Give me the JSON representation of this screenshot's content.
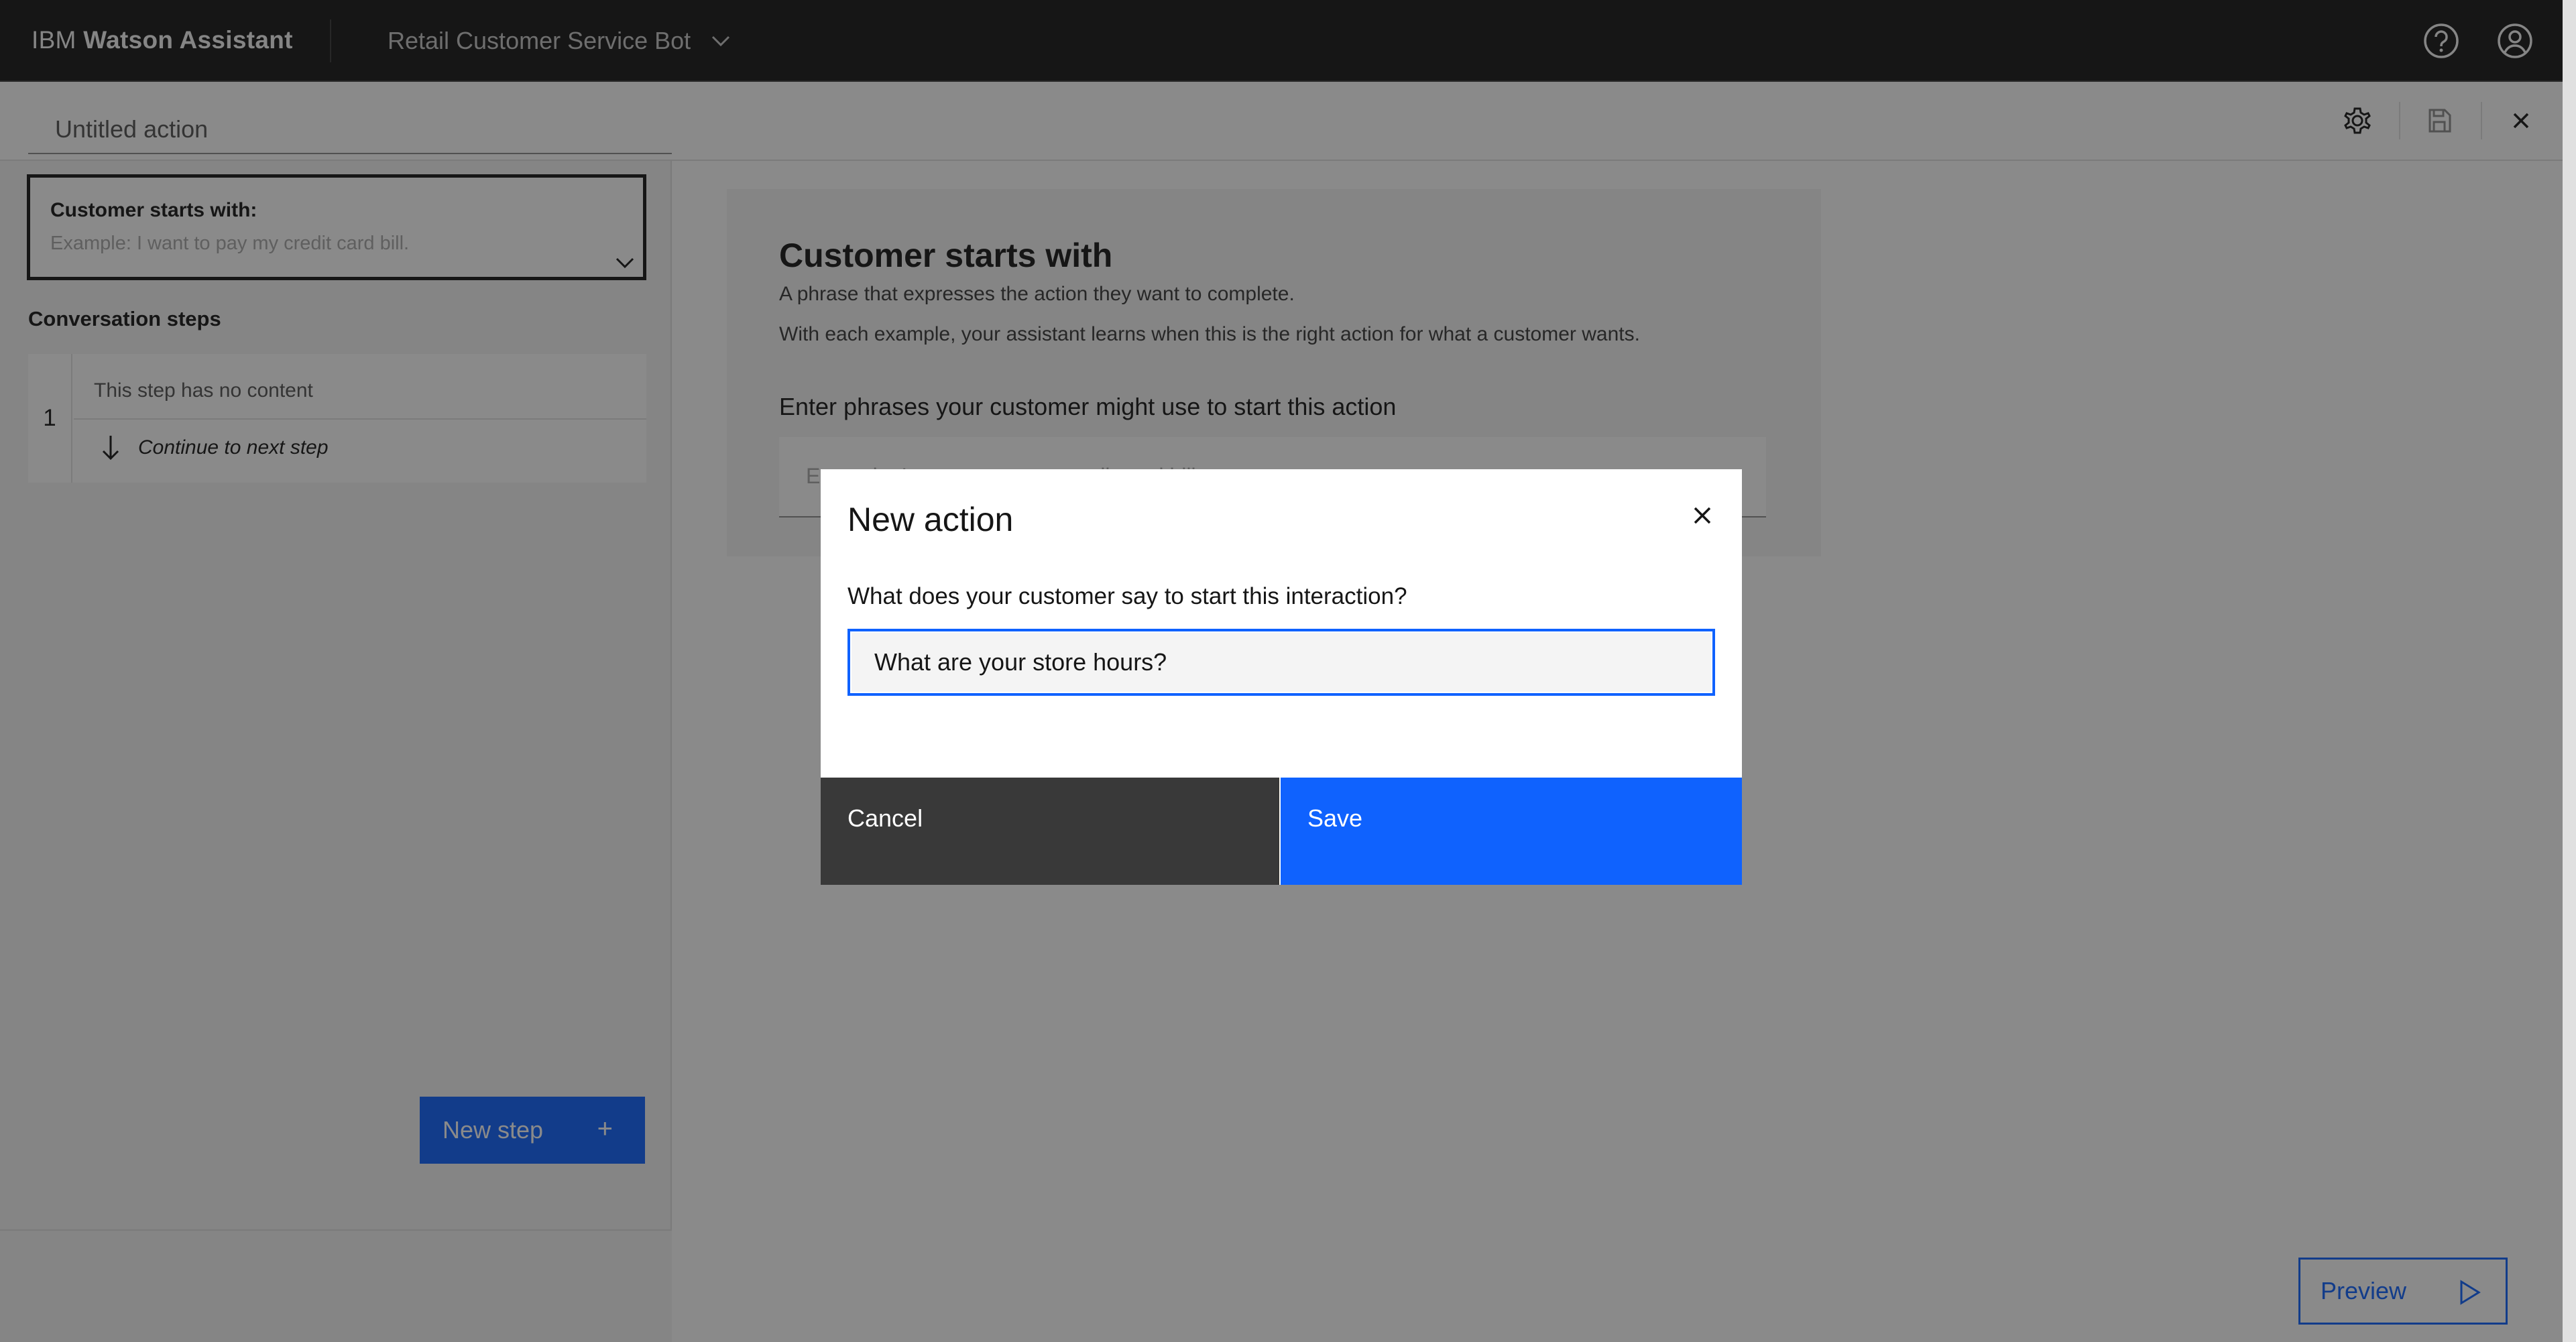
{
  "topbar": {
    "brand_prefix": "IBM",
    "brand_name": "Watson Assistant",
    "assistant_name": "Retail Customer Service Bot",
    "icons": [
      "help-icon",
      "user-profile-icon",
      "chevron-down-icon"
    ]
  },
  "action_header": {
    "title_placeholder": "Untitled action",
    "icons": [
      "settings-icon",
      "save-icon",
      "close-icon"
    ]
  },
  "left_panel": {
    "starts_with_label": "Customer starts with:",
    "starts_with_placeholder": "Example: I want to pay my credit card bill.",
    "conversation_steps_title": "Conversation steps",
    "steps": [
      {
        "number": "1",
        "content": "This step has no content",
        "next": "Continue to next step"
      }
    ],
    "new_step_label": "New step",
    "new_step_icon": "+"
  },
  "main": {
    "heading": "Customer starts with",
    "description_1": "A phrase that expresses the action they want to complete.",
    "description_2": "With each example, your assistant learns when this is the right action for what a customer wants.",
    "prompt": "Enter phrases your customer might use to start this action",
    "input_placeholder": "Example: I want to pay my credit card bill."
  },
  "preview_label": "Preview",
  "modal": {
    "title": "New action",
    "label": "What does your customer say to start this interaction?",
    "input_value": "What are your store hours?",
    "cancel_label": "Cancel",
    "save_label": "Save"
  },
  "colors": {
    "primary": "#0f62fe",
    "topbar": "#161616",
    "cancel": "#393939"
  }
}
